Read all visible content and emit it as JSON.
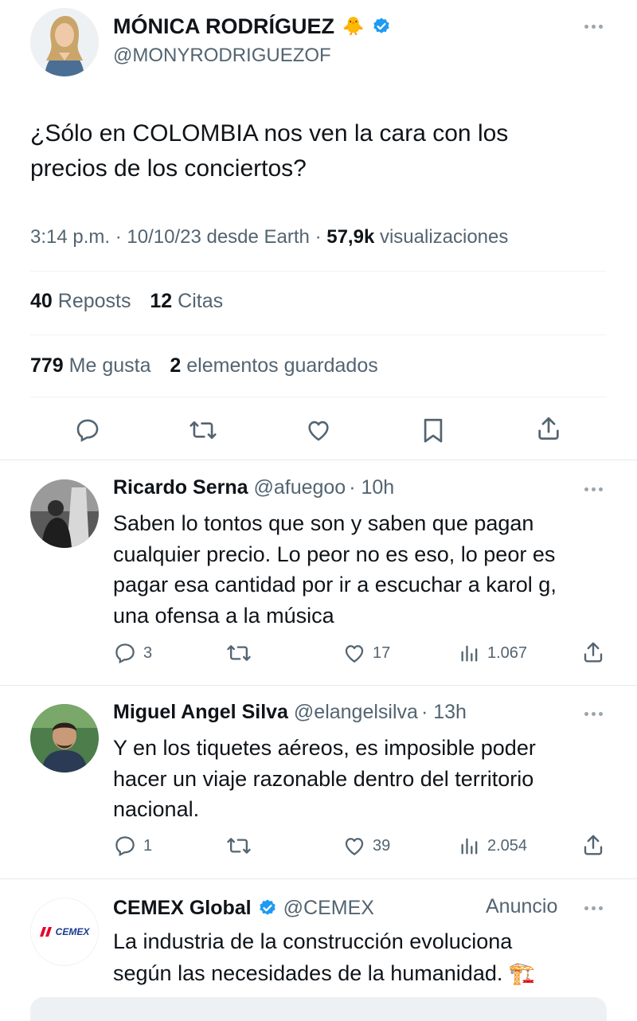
{
  "main_tweet": {
    "author_name": "MÓNICA RODRÍGUEZ",
    "emoji": "🐥",
    "handle": "@MONYRODRIGUEZOF",
    "text_line1": "¿Sólo en COLOMBIA nos ven la cara con los",
    "text_line2": "precios de los conciertos?",
    "meta_time": "3:14 p.m. · 10/10/23 desde Earth · ",
    "views_count": "57,9k",
    "views_label": " visualizaciones",
    "reposts_count": "40",
    "reposts_label": "Reposts",
    "quotes_count": "12",
    "quotes_label": "Citas",
    "likes_count": "779",
    "likes_label": "Me gusta",
    "saves_count": "2",
    "saves_label": "elementos guardados"
  },
  "replies": [
    {
      "name": "Ricardo Serna",
      "handle": "@afuegoo",
      "time": "· 10h",
      "lines": [
        "Saben lo tontos que son y saben que pagan",
        "cualquier precio. Lo peor no es eso, lo peor es",
        "pagar esa cantidad por ir a escuchar a karol g,",
        "una ofensa a la música"
      ],
      "replies": "3",
      "likes": "17",
      "views": "1.067"
    },
    {
      "name": "Miguel Angel Silva",
      "handle": "@elangelsilva",
      "time": "· 13h",
      "lines": [
        "Y en los tiquetes aéreos, es imposible poder",
        "hacer un viaje razonable dentro del territorio",
        "nacional."
      ],
      "replies": "1",
      "likes": "39",
      "views": "2.054"
    }
  ],
  "ad": {
    "name": "CEMEX Global",
    "handle": "@CEMEX",
    "label": "Anuncio",
    "logo_text": "CEMEX",
    "line1": "La industria de la construcción evoluciona",
    "line2": "según las necesidades de la humanidad.",
    "emoji": "🏗️"
  },
  "colors": {
    "verified": "#1d9bf0",
    "muted": "#536471",
    "text": "#0f1419",
    "cemex_red": "#e4002b",
    "cemex_blue": "#1a3a8f"
  },
  "icons": [
    "reply-icon",
    "repost-icon",
    "like-icon",
    "bookmark-icon",
    "share-icon",
    "views-icon",
    "verified-icon",
    "more-icon"
  ]
}
